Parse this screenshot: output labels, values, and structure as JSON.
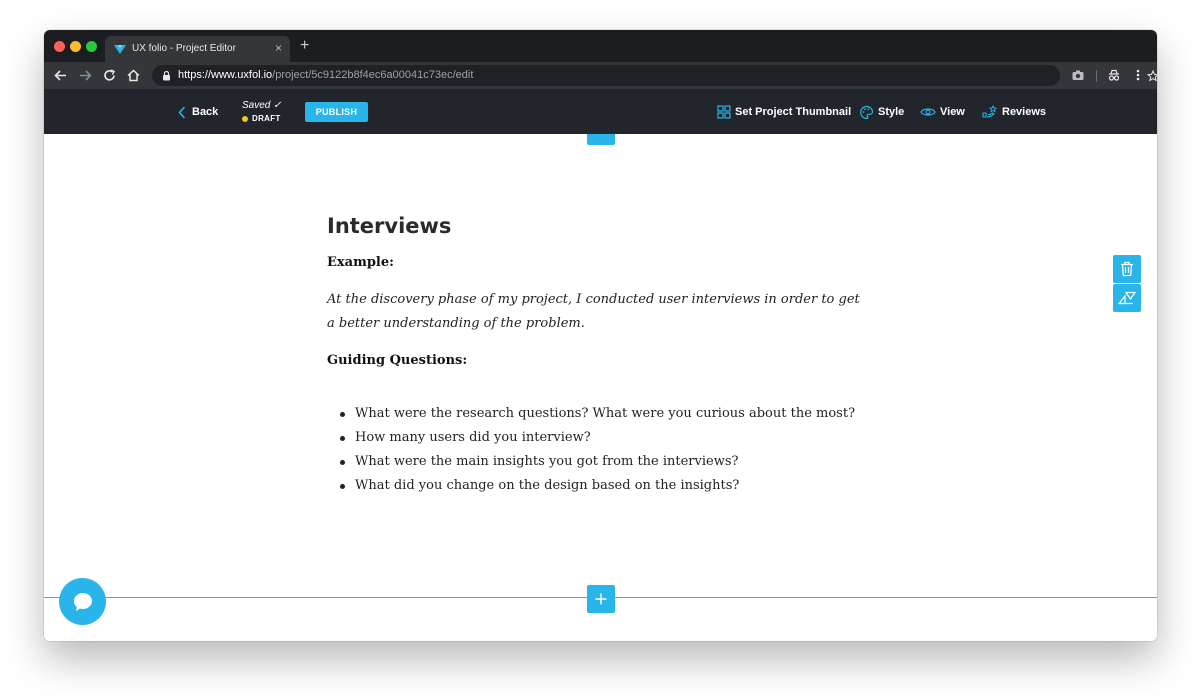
{
  "browser": {
    "tab_title": "UX folio - Project Editor",
    "tab_close": "×",
    "new_tab": "+",
    "url_prefix": "https://",
    "url_host": "www.uxfol.io",
    "url_path": "/project/5c9122b8f4ec6a00041c73ec/edit"
  },
  "appbar": {
    "back_label": "Back",
    "saved_label": "Saved ✓",
    "draft_label": "DRAFT",
    "publish_label": "PUBLISH",
    "actions": {
      "thumbnail": "Set Project Thumbnail",
      "style": "Style",
      "view": "View",
      "reviews": "Reviews"
    }
  },
  "article": {
    "title": "Interviews",
    "example_heading": "Example:",
    "example_text": "At the discovery phase of my project, I conducted user interviews in order to get a better understanding of the problem.",
    "guiding_heading": "Guiding Questions:",
    "questions": [
      "What were the research questions? What were you curious about the most?",
      "How many users did you interview?",
      "What were the main insights you got from the interviews?",
      "What did you change on the design based on the insights?"
    ]
  },
  "icons": {
    "side_top": "trash-icon",
    "side_bottom": "triangle-swap-icon",
    "add": "plus-icon",
    "chat": "chat-bubble-icon"
  },
  "colors": {
    "accent": "#29b5ea",
    "appbar_bg": "#22252b",
    "draft_dot": "#f5c518"
  }
}
